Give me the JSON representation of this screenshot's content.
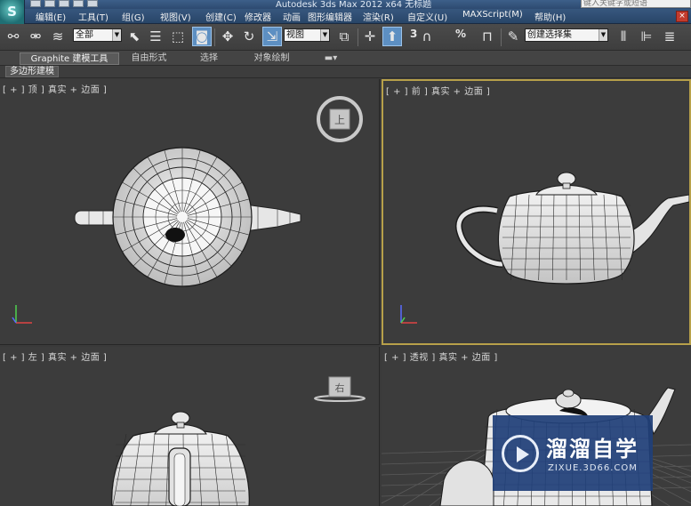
{
  "window": {
    "title": "Autodesk 3ds Max  2012 x64    无标题",
    "search_placeholder": "键入关键字或短语",
    "app_logo_glyph": "S",
    "close_glyph": "×"
  },
  "menu": {
    "items": [
      "编辑(E)",
      "工具(T)",
      "组(G)",
      "视图(V)",
      "创建(C)",
      "修改器",
      "动画",
      "图形编辑器",
      "渲染(R)",
      "自定义(U)",
      "MAXScript(M)",
      "帮助(H)"
    ]
  },
  "toolbar": {
    "selection_filter": "全部",
    "reference_coord": "视图",
    "named_selection_set": "创建选择集",
    "snap_labels": [
      "3",
      "%"
    ],
    "icons": [
      "link-icon",
      "unlink-icon",
      "bind-spacewarp-icon",
      "select-object-icon",
      "select-by-name-icon",
      "rectangular-selection-icon",
      "window-crossing-icon",
      "select-and-move-icon",
      "select-and-rotate-icon",
      "select-and-scale-icon",
      "use-pivot-center-icon",
      "select-and-manipulate-icon",
      "keyboard-shortcut-icon",
      "snaps-toggle-icon",
      "angle-snap-icon",
      "percent-snap-icon",
      "spinner-snap-icon",
      "edit-named-selection-icon",
      "mirror-icon",
      "align-icon",
      "layer-manager-icon"
    ]
  },
  "ribbon": {
    "tabs": [
      "Graphite 建模工具",
      "自由形式",
      "选择",
      "对象绘制"
    ],
    "active_tab": 0,
    "panel_label": "多边形建模"
  },
  "viewports": {
    "top": {
      "label": "[ + ] 顶 ] 真实 + 边面 ]",
      "cube_face": "上"
    },
    "front": {
      "label": "[ + ] 前 ] 真实 + 边面 ]"
    },
    "left": {
      "label": "[ + ] 左 ] 真实 + 边面 ]",
      "cube_face": "右"
    },
    "perspective": {
      "label": "[ + ] 透视 ] 真实 + 边面 ]"
    }
  },
  "watermark": {
    "title": "溜溜自学",
    "url": "ZIXUE.3D66.COM"
  },
  "colors": {
    "viewport_bg": "#3c3c3c",
    "active_viewport_border": "#b7a04a",
    "menu_bar": "#2d4a70",
    "toolbar_bg": "#444444",
    "active_tool": "#5d8fc2",
    "watermark_bg": "#203f78"
  }
}
